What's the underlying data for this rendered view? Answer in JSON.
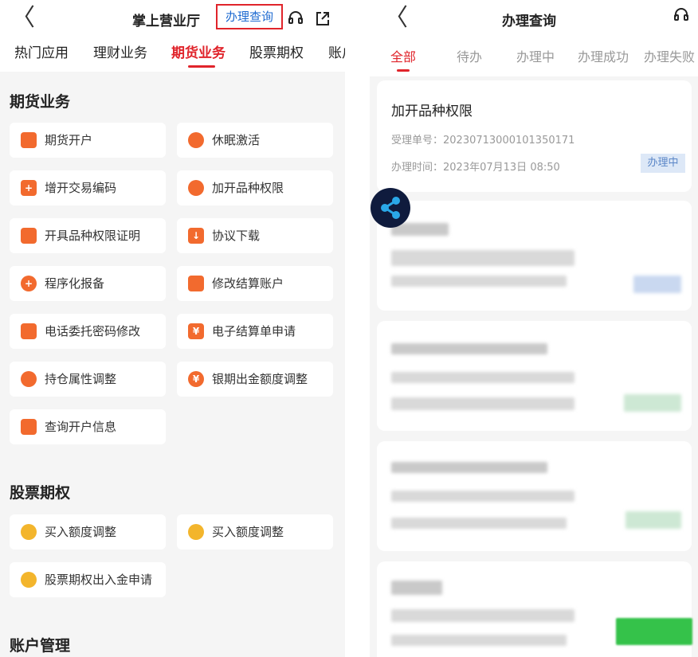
{
  "left": {
    "back_glyph": "〈",
    "title": "掌上营业厅",
    "query_link": "办理查询",
    "tabs": [
      "热门应用",
      "理财业务",
      "期货业务",
      "股票期权",
      "账户"
    ],
    "sections": [
      {
        "heading": "期货业务",
        "items": [
          {
            "label": "期货开户",
            "icon": "calendar-icon"
          },
          {
            "label": "休眠激活",
            "icon": "trophy-icon"
          },
          {
            "label": "增开交易编码",
            "icon": "plus-square-icon"
          },
          {
            "label": "加开品种权限",
            "icon": "shield-icon"
          },
          {
            "label": "开具品种权限证明",
            "icon": "document-icon"
          },
          {
            "label": "协议下载",
            "icon": "download-icon"
          },
          {
            "label": "程序化报备",
            "icon": "shield-plus-icon"
          },
          {
            "label": "修改结算账户",
            "icon": "card-icon"
          },
          {
            "label": "电话委托密码修改",
            "icon": "lock-icon"
          },
          {
            "label": "电子结算单申请",
            "icon": "yen-doc-icon"
          },
          {
            "label": "持仓属性调整",
            "icon": "pie-icon"
          },
          {
            "label": "银期出金额度调整",
            "icon": "yen-coin-icon"
          },
          {
            "label": "查询开户信息",
            "icon": "user-search-icon"
          }
        ]
      },
      {
        "heading": "股票期权",
        "items": [
          {
            "label": "买入额度调整",
            "icon": "coins-icon"
          },
          {
            "label": "买入额度调整",
            "icon": "coins-icon"
          },
          {
            "label": "股票期权出入金申请",
            "icon": "stamp-icon"
          }
        ]
      },
      {
        "heading": "账户管理",
        "items": []
      }
    ]
  },
  "right": {
    "back_glyph": "〈",
    "title": "办理查询",
    "tabs": [
      "全部",
      "待办",
      "办理中",
      "办理成功",
      "办理失败"
    ],
    "record": {
      "title": "加开品种权限",
      "number_label": "受理单号：",
      "number": "20230713000101350171",
      "time_label": "办理时间：",
      "time": "2023年07月13日 08:50",
      "status": "办理中"
    }
  },
  "colors": {
    "accent": "#e0242b",
    "link": "#1f6bd1",
    "badge_bg": "#dde8f7"
  }
}
